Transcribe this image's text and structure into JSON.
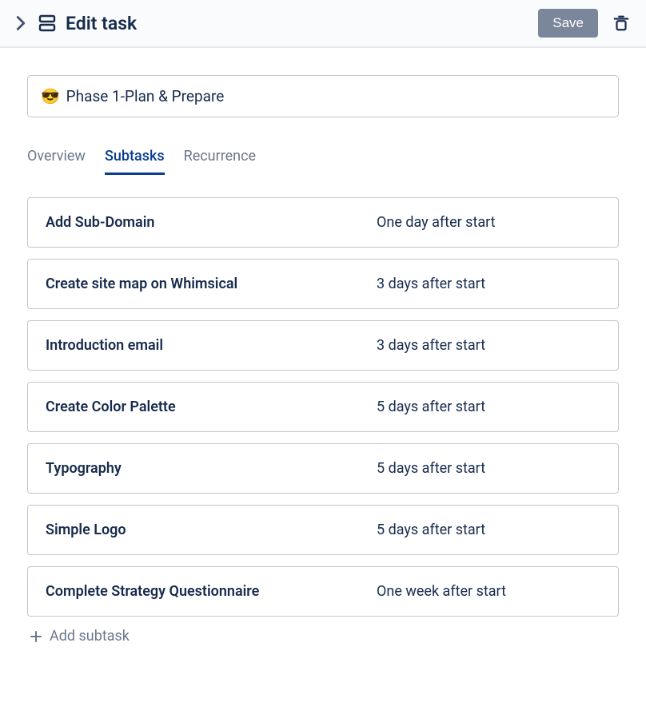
{
  "header": {
    "title": "Edit task",
    "save_label": "Save"
  },
  "task": {
    "emoji": "😎",
    "name": "Phase 1-Plan & Prepare"
  },
  "tabs": [
    {
      "label": "Overview",
      "active": false
    },
    {
      "label": "Subtasks",
      "active": true
    },
    {
      "label": "Recurrence",
      "active": false
    }
  ],
  "subtasks": [
    {
      "name": "Add Sub-Domain",
      "due": "One day after start"
    },
    {
      "name": "Create site map on Whimsical",
      "due": "3 days after start"
    },
    {
      "name": "Introduction email",
      "due": "3 days after start"
    },
    {
      "name": "Create Color Palette",
      "due": "5 days after start"
    },
    {
      "name": "Typography",
      "due": "5 days after start"
    },
    {
      "name": "Simple Logo",
      "due": "5 days after start"
    },
    {
      "name": "Complete Strategy Questionnaire",
      "due": "One week after start"
    }
  ],
  "add_subtask_label": "Add subtask"
}
